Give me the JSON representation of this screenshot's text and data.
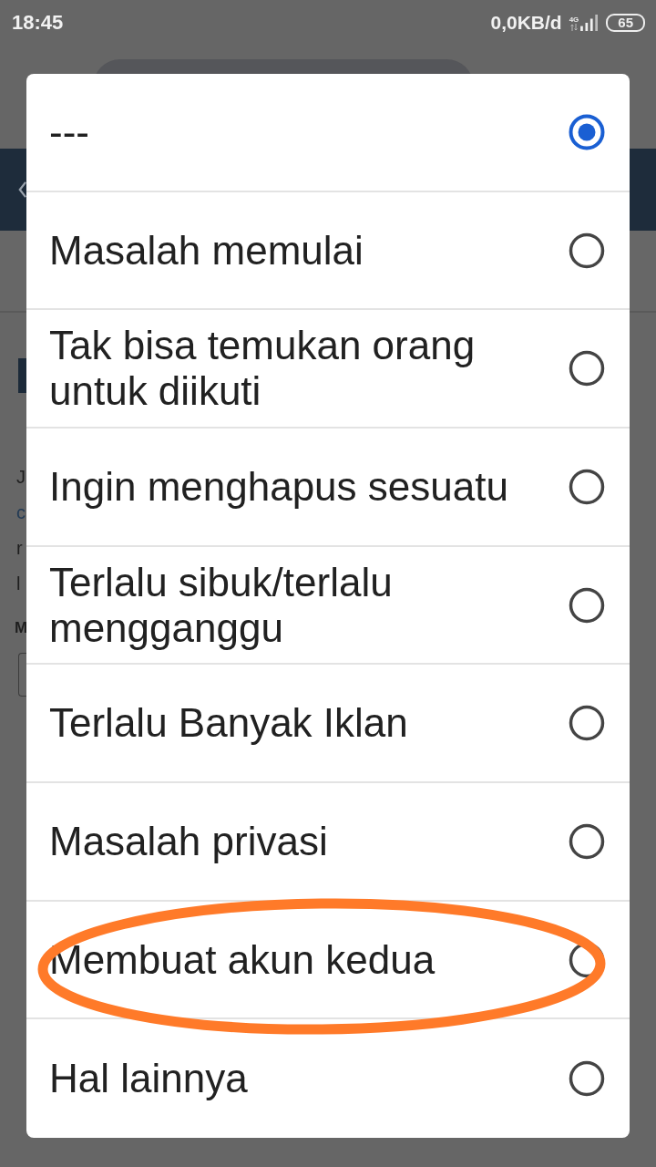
{
  "status_bar": {
    "time": "18:45",
    "data_rate": "0,0KB/d",
    "network": "4G",
    "battery": "65"
  },
  "background_page": {
    "text_fragments": [
      {
        "text": "J",
        "kind": "plain"
      },
      {
        "text": "c",
        "kind": "link"
      },
      {
        "text": "r",
        "kind": "plain"
      },
      {
        "text": "l",
        "kind": "plain"
      },
      {
        "text": "M",
        "kind": "label"
      }
    ]
  },
  "dialog": {
    "options": [
      {
        "label": "---",
        "selected": true,
        "highlighted": false
      },
      {
        "label": "Masalah memulai",
        "selected": false,
        "highlighted": false
      },
      {
        "label": "Tak bisa temukan orang untuk diikuti",
        "selected": false,
        "highlighted": false
      },
      {
        "label": "Ingin menghapus sesuatu",
        "selected": false,
        "highlighted": false
      },
      {
        "label": "Terlalu sibuk/terlalu mengganggu",
        "selected": false,
        "highlighted": false
      },
      {
        "label": "Terlalu Banyak Iklan",
        "selected": false,
        "highlighted": false
      },
      {
        "label": "Masalah privasi",
        "selected": false,
        "highlighted": false
      },
      {
        "label": "Membuat akun kedua",
        "selected": false,
        "highlighted": true
      },
      {
        "label": "Hal lainnya",
        "selected": false,
        "highlighted": false
      }
    ]
  }
}
